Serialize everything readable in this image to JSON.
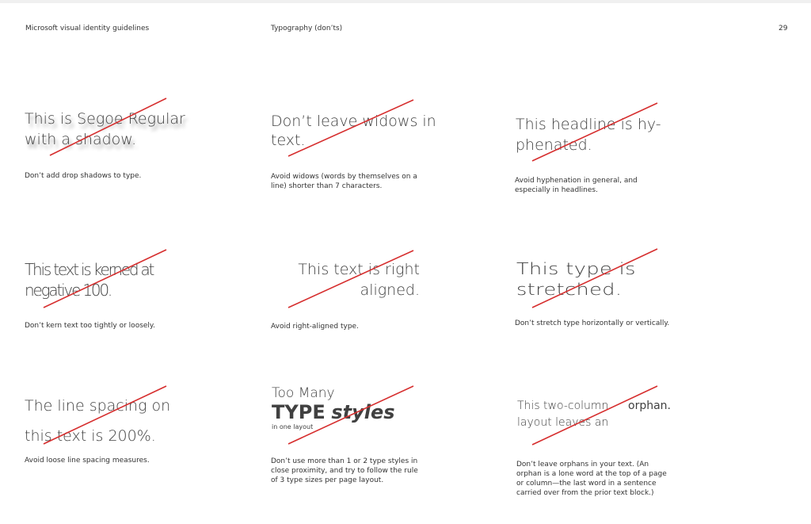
{
  "header": {
    "document_title": "Microsoft visual identity guidelines",
    "section_title": "Typography (don’ts)",
    "page_number": "29"
  },
  "examples": {
    "shadow": {
      "sample_line1": "This is Segoe Regular",
      "sample_line2": "with a shadow.",
      "caption": "Don’t add drop shadows to type."
    },
    "widows": {
      "sample_line1": "Don’t leave widows in",
      "sample_line2": "text.",
      "caption_line1": "Avoid widows (words by themselves on a",
      "caption_line2": "line) shorter than 7 characters."
    },
    "hyphen": {
      "sample_line1": "This headline is hy-",
      "sample_line2": "phenated.",
      "caption_line1": "Avoid hyphenation in general, and",
      "caption_line2": "especially in headlines."
    },
    "kerning": {
      "sample_line1": "This text is kerned at",
      "sample_line2": "negative 100.",
      "caption": "Don’t kern text too tightly or loosely."
    },
    "right": {
      "sample_line1": "This text is right",
      "sample_line2": "aligned.",
      "caption": "Avoid right-aligned type."
    },
    "stretch": {
      "sample_line1": "This type is",
      "sample_line2": "stretched.",
      "caption": "Don’t stretch type horizontally or vertically."
    },
    "spacing": {
      "sample_line1": "The line spacing on",
      "sample_line2": "this text is 200%.",
      "caption": "Avoid loose line spacing measures."
    },
    "styles": {
      "line1": "Too Many",
      "line2_bold": "TYPE",
      "line2_italic": "styles",
      "line3": "in one layout",
      "caption_line1": "Don’t use more than 1 or 2 type styles in",
      "caption_line2": "close proximity, and try to follow the rule",
      "caption_line3": "of 3 type sizes per page layout."
    },
    "orphan": {
      "sample_line1": "This two-column",
      "sample_word_right": "orphan.",
      "sample_line2": "layout leaves an",
      "caption_line1": "Don’t leave orphans in your text. (An",
      "caption_line2": "orphan is a lone word at the top of a page",
      "caption_line3": "or column—the last word in a sentence",
      "caption_line4": "carried over from the prior text block.)"
    }
  },
  "colors": {
    "strike": "#d62e2e",
    "text": "#404040"
  }
}
